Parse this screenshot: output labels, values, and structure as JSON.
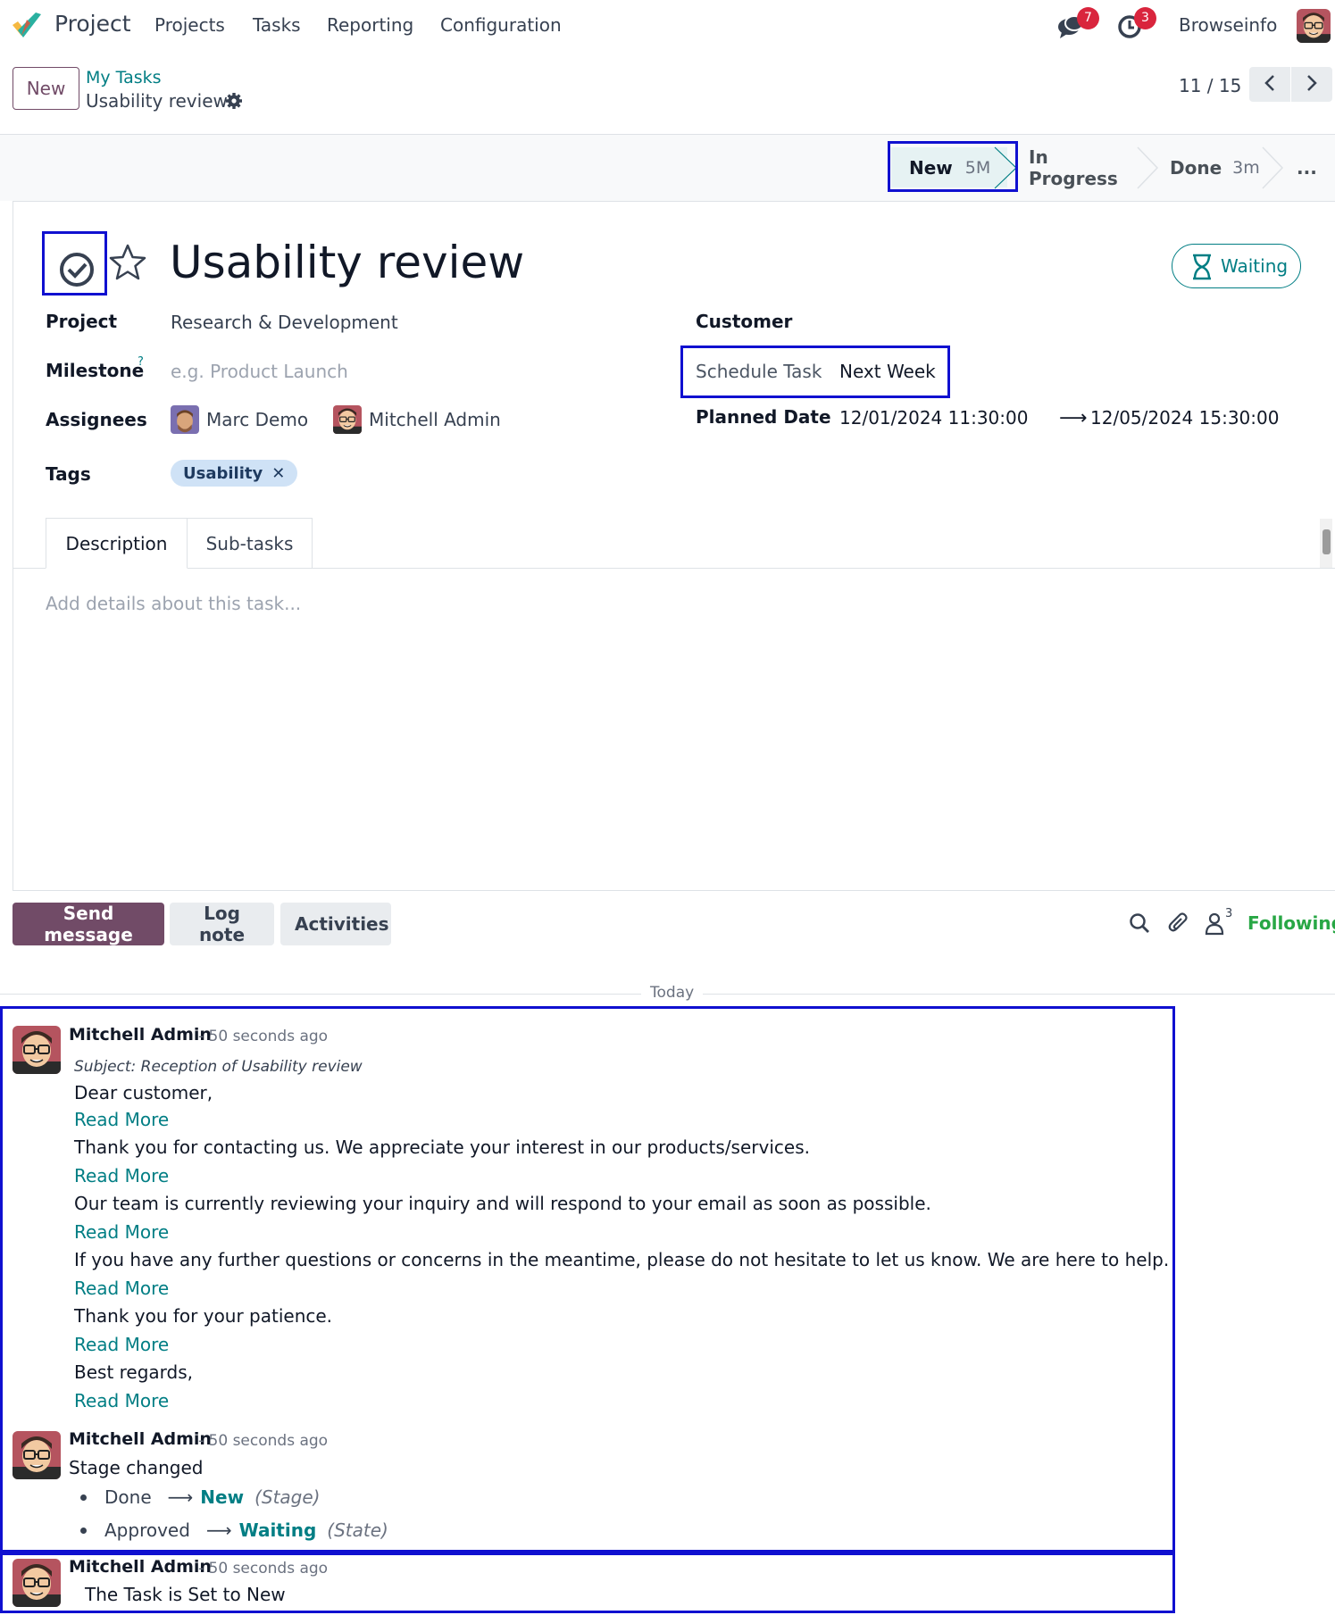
{
  "app": {
    "name": "Project"
  },
  "menu": [
    "Projects",
    "Tasks",
    "Reporting",
    "Configuration"
  ],
  "systray": {
    "messages_count": "7",
    "activities_count": "3",
    "company": "Browseinfo"
  },
  "control": {
    "new_label": "New",
    "breadcrumb_parent": "My Tasks",
    "breadcrumb_current": "Usability review",
    "pager": "11 / 15"
  },
  "stages": {
    "new": {
      "label": "New",
      "duration": "5M"
    },
    "in_progress": {
      "label": "In Progress"
    },
    "done": {
      "label": "Done",
      "duration": "3m"
    },
    "more": "..."
  },
  "task": {
    "title": "Usability review",
    "state_badge": "Waiting",
    "fields": {
      "project_label": "Project",
      "project_value": "Research & Development",
      "milestone_label": "Milestone",
      "milestone_help": "?",
      "milestone_placeholder": "e.g. Product Launch",
      "assignees_label": "Assignees",
      "assignees": [
        "Marc Demo",
        "Mitchell Admin"
      ],
      "tags_label": "Tags",
      "tags": [
        "Usability"
      ],
      "customer_label": "Customer",
      "schedule_label": "Schedule Task",
      "schedule_value": "Next Week",
      "planned_label": "Planned Date",
      "planned_start": "12/01/2024 11:30:00",
      "planned_end": "12/05/2024 15:30:00"
    },
    "tabs": [
      "Description",
      "Sub-tasks"
    ],
    "description_placeholder": "Add details about this task..."
  },
  "chatter": {
    "send_message": "Send message",
    "log_note": "Log note",
    "activities": "Activities",
    "followers_count": "3",
    "following": "Following",
    "date_separator": "Today",
    "messages": [
      {
        "author": "Mitchell Admin",
        "ago": "- 50 seconds ago",
        "subject": "Subject: Reception of Usability review",
        "lines": [
          "Dear customer,",
          "Thank you for contacting us. We appreciate your interest in our products/services.",
          "Our team is currently reviewing your inquiry and will respond to your email as soon as possible.",
          "If you have any further questions or concerns in the meantime, please do not hesitate to let us know. We are here to help.",
          "Thank you for your patience.",
          "Best regards,"
        ],
        "read_more": "Read More"
      },
      {
        "author": "Mitchell Admin",
        "ago": "- 50 seconds ago",
        "text": "Stage changed",
        "tracking": [
          {
            "old": "Done",
            "new": "New",
            "field": "(Stage)"
          },
          {
            "old": "Approved",
            "new": "Waiting",
            "field": "(State)"
          }
        ]
      },
      {
        "author": "Mitchell Admin",
        "ago": "- 50 seconds ago",
        "text": "The Task is Set to New"
      }
    ]
  },
  "colors": {
    "brand": "#714b67",
    "link": "#017e84",
    "highlight": "#1010d0",
    "badge": "#d9253d"
  }
}
